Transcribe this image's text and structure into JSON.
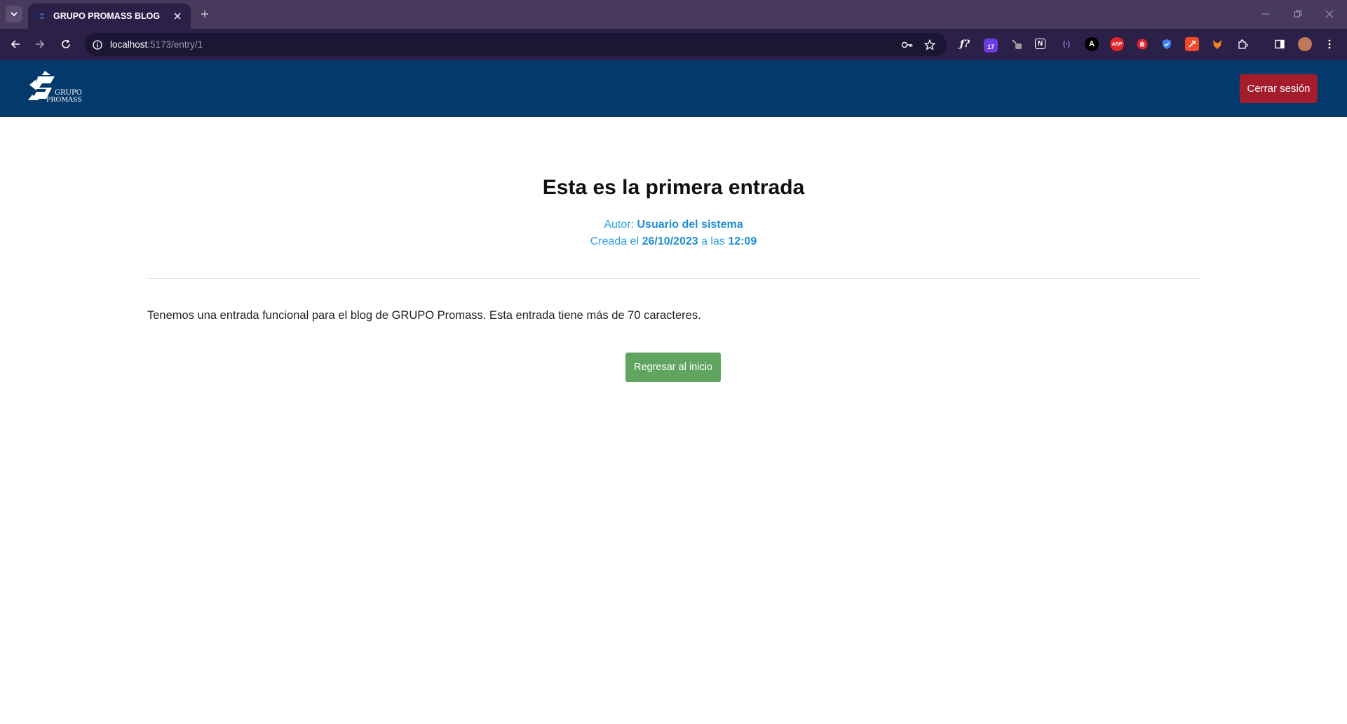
{
  "browser": {
    "tab_title": "GRUPO PROMASS BLOG",
    "url_host": "localhost",
    "url_rest": ":5173/entry/1",
    "extensions": [
      {
        "name": "fx-extension-icon",
        "label": "ƒ?"
      },
      {
        "name": "calendar-extension-icon",
        "label": "17"
      },
      {
        "name": "dropper-extension-icon",
        "label": ""
      },
      {
        "name": "notion-extension-icon",
        "label": "N"
      },
      {
        "name": "bracket-extension-icon",
        "label": "(·)"
      },
      {
        "name": "a-extension-icon",
        "label": "A"
      },
      {
        "name": "adblock-extension-icon",
        "label": "ABP"
      },
      {
        "name": "hand-extension-icon",
        "label": ""
      },
      {
        "name": "shield-extension-icon",
        "label": ""
      },
      {
        "name": "rocket-extension-icon",
        "label": ""
      },
      {
        "name": "fox-extension-icon",
        "label": ""
      }
    ]
  },
  "header": {
    "logo_text_line1": "GRUPO",
    "logo_text_line2": "PROMASS",
    "logout_label": "Cerrar sesión"
  },
  "entry": {
    "title": "Esta es la primera entrada",
    "author_prefix": "Autor: ",
    "author": "Usuario del sistema",
    "created_prefix": "Creada el ",
    "date": "26/10/2023",
    "time_prefix": " a las ",
    "time": "12:09",
    "body": "Tenemos una entrada funcional para el blog de GRUPO Promass. Esta entrada tiene más de 70 caracteres.",
    "back_label": "Regresar al inicio"
  },
  "colors": {
    "navbar": "#04396b",
    "logout": "#a51d2d",
    "back_button": "#5fa55f",
    "meta": "#2b9fe0"
  }
}
